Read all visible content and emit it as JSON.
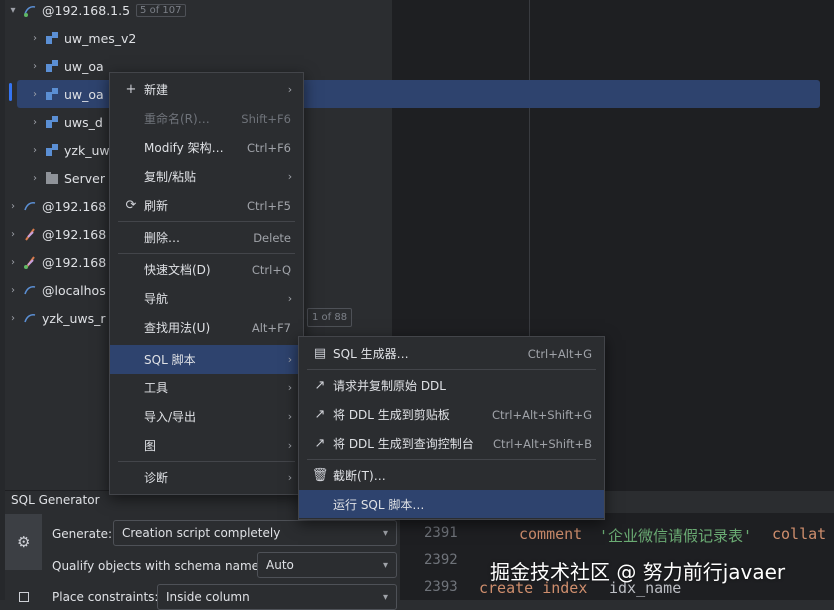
{
  "tree": {
    "root": {
      "label": "@192.168.1.5",
      "badge": "5 of 107",
      "icon": "mysql-connection-icon"
    },
    "schemas": [
      {
        "label": "uw_mes_v2"
      },
      {
        "label": "uw_oa"
      },
      {
        "label": "uw_oa"
      },
      {
        "label": "uws_d"
      },
      {
        "label": "yzk_uw"
      },
      {
        "label": "Server"
      }
    ],
    "connections": [
      {
        "label": "@192.168"
      },
      {
        "label": "@192.168"
      },
      {
        "label": "@192.168"
      },
      {
        "label": "@localhos"
      },
      {
        "label": "yzk_uws_r",
        "badge": "1 of 88"
      }
    ]
  },
  "context_menu": {
    "items": [
      {
        "icon": "+",
        "label": "新建",
        "shortcut": ""
      },
      {
        "icon": "",
        "label": "重命名(R)…",
        "shortcut": "Shift+F6"
      },
      {
        "icon": "",
        "label": "Modify 架构…",
        "shortcut": "Ctrl+F6"
      },
      {
        "icon": "",
        "label": "复制/粘贴",
        "shortcut": ""
      },
      {
        "icon": "⟳",
        "label": "刷新",
        "shortcut": "Ctrl+F5"
      },
      {
        "icon": "",
        "label": "删除…",
        "shortcut": "Delete"
      },
      {
        "icon": "",
        "label": "快速文档(D)",
        "shortcut": "Ctrl+Q"
      },
      {
        "icon": "",
        "label": "导航",
        "shortcut": ""
      },
      {
        "icon": "",
        "label": "查找用法(U)",
        "shortcut": "Alt+F7"
      },
      {
        "icon": "",
        "label": "SQL 脚本",
        "shortcut": ""
      },
      {
        "icon": "",
        "label": "工具",
        "shortcut": ""
      },
      {
        "icon": "",
        "label": "导入/导出",
        "shortcut": ""
      },
      {
        "icon": "",
        "label": "图",
        "shortcut": ""
      },
      {
        "icon": "",
        "label": "诊断",
        "shortcut": ""
      }
    ]
  },
  "submenu": {
    "items": [
      {
        "icon": "▤",
        "label": "SQL 生成器…",
        "shortcut": "Ctrl+Alt+G"
      },
      {
        "icon": "↗",
        "label": "请求并复制原始 DDL",
        "shortcut": ""
      },
      {
        "icon": "↗",
        "label": "将 DDL 生成到剪贴板",
        "shortcut": "Ctrl+Alt+Shift+G"
      },
      {
        "icon": "↗",
        "label": "将 DDL 生成到查询控制台",
        "shortcut": "Ctrl+Alt+Shift+B"
      },
      {
        "icon": "🗑",
        "label": "截断(T)…",
        "shortcut": ""
      },
      {
        "icon": "",
        "label": "运行 SQL 脚本…",
        "shortcut": ""
      }
    ]
  },
  "sql_generator": {
    "title": "SQL Generator",
    "generate_label": "Generate:",
    "generate_value": "Creation script completely",
    "qualify_label": "Qualify objects with schema names:",
    "qualify_value": "Auto",
    "place_label": "Place constraints:",
    "place_value": "Inside column"
  },
  "editor": {
    "line_numbers": [
      "2391",
      "2392",
      "2393"
    ],
    "line1_kw": "comment",
    "line1_str": "'企业微信请假记录表'",
    "line1_tail": "collat",
    "line3_kw": "create index",
    "line3_tail": "idx_name"
  },
  "watermark": "掘金技术社区 @ 努力前行javaer"
}
